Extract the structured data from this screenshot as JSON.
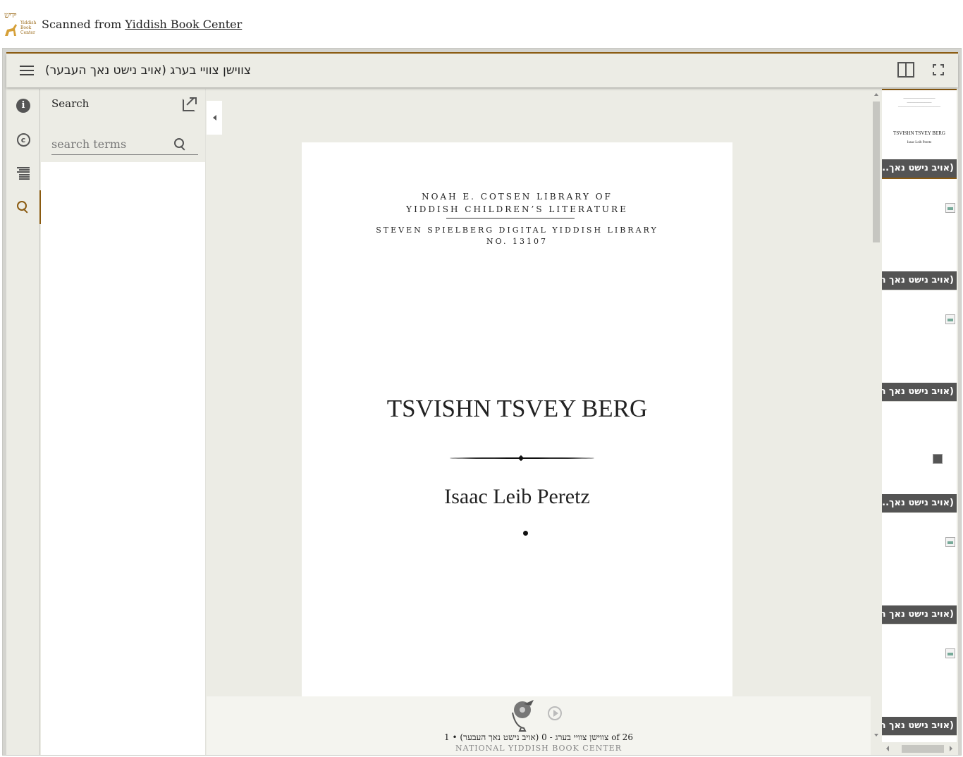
{
  "attribution": {
    "logo_text": "יידיש",
    "logo_sub": [
      "Yiddish",
      "Book",
      "Center"
    ],
    "prefix": "Scanned from ",
    "link": "Yiddish Book Center"
  },
  "topbar": {
    "title": "צווישן צוויי בערג (אויב נישט נאך העבער)"
  },
  "search_panel": {
    "title": "Search",
    "placeholder": "search terms"
  },
  "page": {
    "library_line1": "NOAH E. COTSEN LIBRARY OF",
    "library_line2": "YIDDISH CHILDREN’S LITERATURE",
    "library_line3": "STEVEN SPIELBERG DIGITAL YIDDISH LIBRARY",
    "library_line4": "NO. 13107",
    "title": "TSVISHN TSVEY BERG",
    "author": "Isaac Leib Peretz"
  },
  "footer": {
    "page_label": "צווישן צוויי בערג - 0 (אויב נישט נאך העבער) • 1 of 26",
    "credit": "NATIONAL YIDDISH BOOK CENTER"
  },
  "thumbnails": [
    {
      "caption": "(אויב נישט נאך...",
      "mini_title": "TSVISHN TSVEY BERG",
      "mini_author": "Isaac Leib Peretz"
    },
    {
      "caption": "(אויב נישט נאך העבער"
    },
    {
      "caption": "(אויב נישט נאך העבער"
    },
    {
      "caption": "(אויב נישט נאך..."
    },
    {
      "caption": "(אויב נישט נאך העבער"
    },
    {
      "caption": "(אויב נישט נאך העבער"
    }
  ],
  "colors": {
    "accent": "#8a5a10",
    "chrome": "#ecece5"
  }
}
